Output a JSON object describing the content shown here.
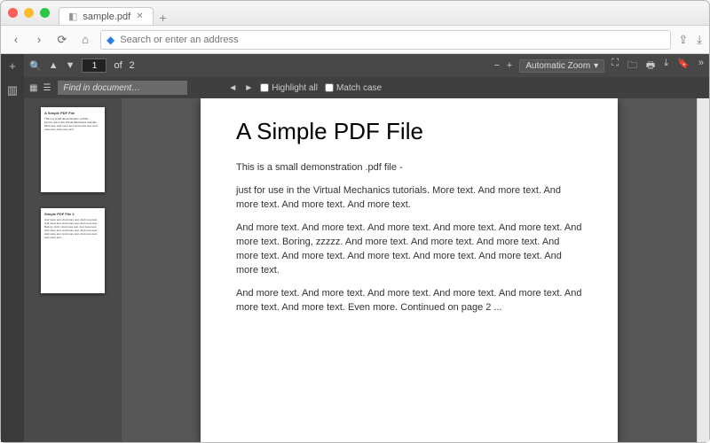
{
  "window": {
    "tab_title": "sample.pdf"
  },
  "addressbar": {
    "placeholder": "Search or enter an address"
  },
  "pdftoolbar": {
    "current_page": "1",
    "page_sep": "of",
    "total_pages": "2",
    "zoom_label": "Automatic Zoom"
  },
  "findbar": {
    "placeholder": "Find in document…",
    "highlight_label": "Highlight all",
    "matchcase_label": "Match case"
  },
  "document": {
    "title": "A Simple PDF File",
    "p1": "This is a small demonstration .pdf file -",
    "p2": "just for use in the Virtual Mechanics tutorials. More text. And more text. And more text. And more text. And more text.",
    "p3": "And more text. And more text. And more text. And more text. And more text. And more text. Boring, zzzzz. And more text. And more text. And more text. And more text. And more text. And more text. And more text. And more text. And more text.",
    "p4": "And more text. And more text. And more text. And more text. And more text. And more text. And more text. Even more. Continued on page 2 ..."
  },
  "thumbs": {
    "page2_title": "Simple PDF File 2"
  }
}
